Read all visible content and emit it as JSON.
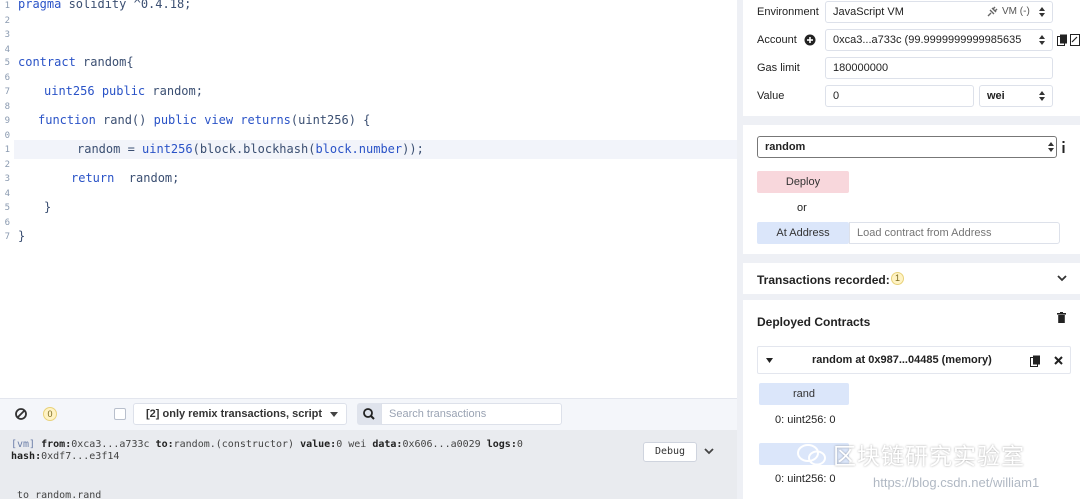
{
  "editor": {
    "line_numbers": [
      "1",
      "2",
      "3",
      "4",
      "5",
      "6",
      "7",
      "8",
      "9",
      "0",
      "1",
      "2",
      "3",
      "4",
      "5",
      "6",
      "7"
    ],
    "code": {
      "pragma_kw": "pragma",
      "pragma_rest": " solidity ^0.4.18;",
      "contract_kw": "contract",
      "contract_rest": " random{",
      "state_type": "uint256",
      "state_public": "public",
      "state_rest": " random;",
      "fn_kw": "function",
      "fn_name": " rand() ",
      "fn_public": "public",
      "fn_view": "view",
      "fn_returns": "returns",
      "fn_rest": "(uint256) {",
      "assign_lhs": "random = ",
      "assign_call": "uint256",
      "assign_rest": "(block.blockhash(",
      "assign_arg": "block.number",
      "assign_end": "));",
      "return_kw": "return",
      "return_rest": "  random;",
      "close_inner": "}",
      "close_outer": "}"
    }
  },
  "terminal_bar": {
    "pending_count": "0",
    "filter_label": "[2] only remix transactions, script",
    "search_placeholder": "Search transactions"
  },
  "terminal": {
    "tag": "[vm]",
    "from_label": "from:",
    "from_value": "0xca3...a733c",
    "to_label": "to:",
    "to_value": "random.(constructor)",
    "value_label": "value:",
    "value_value": "0 wei",
    "data_label": "data:",
    "data_value": "0x606...a0029",
    "logs_label": "logs:",
    "logs_value": "0",
    "hash_label": "hash:",
    "hash_value": "0xdf7...e3f14",
    "debug_label": "Debug",
    "tail_text": " to random.rand"
  },
  "run_panel": {
    "environment_label": "Environment",
    "environment_value": "JavaScript VM",
    "environment_vm": "VM (-)",
    "account_label": "Account",
    "account_value": "0xca3...a733c (99.9999999999985635",
    "gas_limit_label": "Gas limit",
    "gas_limit_value": "180000000",
    "value_label": "Value",
    "value_value": "0",
    "value_unit": "wei",
    "contract_select": "random",
    "deploy_label": "Deploy",
    "or_label": "or",
    "at_address_label": "At Address",
    "at_address_placeholder": "Load contract from Address"
  },
  "transactions": {
    "title": "Transactions recorded:",
    "count": "1"
  },
  "deployed": {
    "title": "Deployed Contracts",
    "instance_label": "random at 0x987...04485 (memory)",
    "fn_rand_label": "rand",
    "result_1": "0: uint256: 0",
    "result_2": "0: uint256: 0"
  },
  "watermark": {
    "main": "区块链研究实验室",
    "url": "https://blog.csdn.net/william1"
  },
  "colors": {
    "deploy_bg": "#f8d7dc",
    "call_bg": "#dbe6fa",
    "keyword": "#2a53c7",
    "code_text": "#3b4f72"
  }
}
